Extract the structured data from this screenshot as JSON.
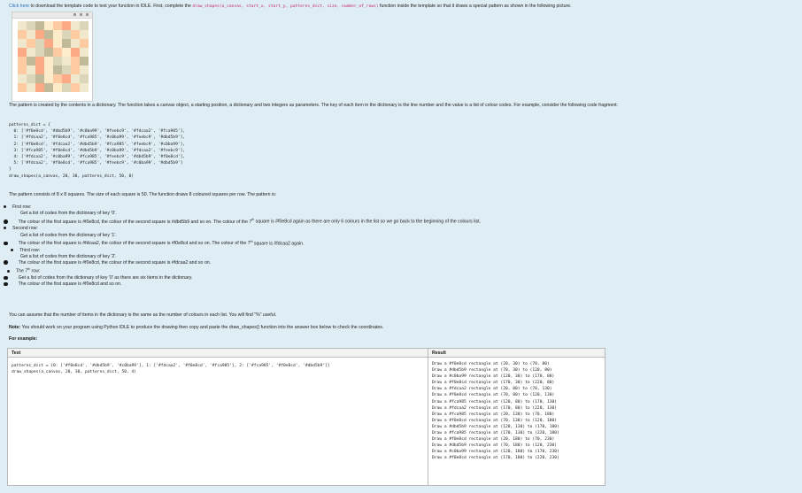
{
  "intro": {
    "link": "Click here",
    "text1": " to download the template code to test your function in IDLE. First, complete the ",
    "func_sig": "draw_shapes(a_canvas, start_x, start_y, patterns_dict, size, number_of_rows)",
    "text2": " function inside the template so that it draws a special pattern as shown in the following picture."
  },
  "thumbnail": {
    "cols": 8,
    "rows": 8,
    "cells": [
      "#f0e8cd",
      "#dbd5b9",
      "#c0ba99",
      "#feebc9",
      "#fdcaa2",
      "#fca985",
      "#f0e8cd",
      "#dbd5b9",
      "#fdcaa2",
      "#f0e8cd",
      "#fca985",
      "#c0ba99",
      "#feebc9",
      "#dbd5b9",
      "#fdcaa2",
      "#f0e8cd",
      "#f0e8cd",
      "#fdcaa2",
      "#dbd5b9",
      "#fca985",
      "#feebc9",
      "#c0ba99",
      "#f0e8cd",
      "#fdcaa2",
      "#fca985",
      "#f0e8cd",
      "#dbd5b9",
      "#c0ba99",
      "#fdcaa2",
      "#feebc9",
      "#fca985",
      "#f0e8cd",
      "#fdcaa2",
      "#c0ba99",
      "#fca985",
      "#feebc9",
      "#dbd5b9",
      "#f0e8cd",
      "#fdcaa2",
      "#c0ba99",
      "#fdcaa2",
      "#f0e8cd",
      "#fca985",
      "#feebc9",
      "#c0ba99",
      "#dbd5b9",
      "#fdcaa2",
      "#f0e8cd",
      "#f0e8cd",
      "#dbd5b9",
      "#c0ba99",
      "#feebc9",
      "#fdcaa2",
      "#fca985",
      "#f0e8cd",
      "#dbd5b9",
      "#fdcaa2",
      "#f0e8cd",
      "#fca985",
      "#c0ba99",
      "#feebc9",
      "#dbd5b9",
      "#fdcaa2",
      "#f0e8cd"
    ]
  },
  "desc": {
    "para1": "The pattern is created by the contents in a dictionary. The function takes a canvas object, a starting position, a dictionary and two integers as parameters. The key of each item in the dictionary is the line number and the value is a list of colour codes. For example, consider the following code fragment:",
    "code": [
      "patterns_dict = {",
      "  0: ['#f0e8cd', '#dbd5b9', '#c0ba99', '#feebc9', '#fdcaa2', '#fca985'],",
      "  1: ['#fdcaa2', '#f0e8cd', '#fca985', '#c0ba99', '#feebc9', '#dbd5b9'],",
      "  2: ['#f0e8cd', '#fdcaa2', '#dbd5b9', '#fca985', '#feebc9', '#c0ba99'],",
      "  3: ['#fca985', '#f0e8cd', '#dbd5b9', '#c0ba99', '#fdcaa2', '#feebc9'],",
      "  4: ['#fdcaa2', '#c0ba99', '#fca985', '#feebc9', '#dbd5b9', '#f0e8cd'],",
      "  5: ['#fdcaa2', '#f0e8cd', '#fca985', '#feebc9', '#c0ba99', '#dbd5b9']",
      "}",
      "draw_shapes(a_canvas, 20, 30, patterns_dict, 50, 8)"
    ],
    "para2": "The pattern consists of 8 x 8 squares. The size of each square is 50. The function draws 8 coloured squares per row. The pattern is:"
  },
  "rows_list": {
    "first": "First row:",
    "first_a": "Get a list of codes from the dictionary of key '0'.",
    "first_b1": "The colour of the first square is #f0e8cd, the colour of the second square is #dbd5b9 and so on. The colour of the 7",
    "first_b2": " square is #f0e8cd again as there are only 6 colours in the list so we go back to the beginning of the colours list.",
    "second": "Second row:",
    "second_a": "Get a list of codes from the dictionary of key '1'.",
    "second_b1": "The colour of the first square is #fdcaa2, the colour of the second square is #f0e8cd and so on. The colour of the 7",
    "second_b2": " square is #fdcaa2 again.",
    "third": "Third row:",
    "third_a": "Get a list of codes from the dictionary of key '2'.",
    "third_b": "The colour of the first square is #f0e8cd, the colour of the second square is #fdcaa2 and so on.",
    "seventh1": "The 7",
    "seventh2": " row:",
    "seventh_a": "Get a list of codes from the dictionary of key '0' as there are six items in the dictionary.",
    "seventh_b": "The colour of the first square is #f0e8cd and so on.",
    "th": "th"
  },
  "notes": {
    "assume": "You can assume that the number of items in the dictionary is the same as the number of colours in each list. You will find \"%\" useful.",
    "note_label": "Note:",
    "note_text1": " You should work on your program using Python IDLE to produce the drawing then copy and paste the ",
    "note_func": "draw_shapes()",
    "note_text2": " function into the answer box below to check the coordinates.",
    "example": "For example:"
  },
  "table": {
    "col_test": "Test",
    "col_result": "Result",
    "test_lines": [
      "patterns_dict = {0: ['#f0e8cd', '#dbd5b9', '#c0ba99'], 1: ['#fdcaa2', '#f0e8cd', '#fca985'], 2: ['#fca985', '#f0e8cd', '#dbd5b9']}",
      "draw_shapes(a_canvas, 20, 30, patterns_dict, 50, 4)"
    ],
    "result_lines": [
      "Draw a #f0e8cd rectangle at (20, 30) to (70, 80)",
      "Draw a #dbd5b9 rectangle at (70, 30) to (120, 80)",
      "Draw a #c0ba99 rectangle at (120, 30) to (170, 80)",
      "Draw a #f0e8cd rectangle at (170, 30) to (220, 80)",
      "Draw a #fdcaa2 rectangle at (20, 80) to (70, 130)",
      "Draw a #f0e8cd rectangle at (70, 80) to (120, 130)",
      "Draw a #fca985 rectangle at (120, 80) to (170, 130)",
      "Draw a #fdcaa2 rectangle at (170, 80) to (220, 130)",
      "Draw a #fca985 rectangle at (20, 130) to (70, 180)",
      "Draw a #f0e8cd rectangle at (70, 130) to (120, 180)",
      "Draw a #dbd5b9 rectangle at (120, 130) to (170, 180)",
      "Draw a #fca985 rectangle at (170, 130) to (220, 180)",
      "Draw a #f0e8cd rectangle at (20, 180) to (70, 230)",
      "Draw a #dbd5b9 rectangle at (70, 180) to (120, 230)",
      "Draw a #c0ba99 rectangle at (120, 180) to (170, 230)",
      "Draw a #f0e8cd rectangle at (170, 180) to (220, 230)"
    ]
  }
}
